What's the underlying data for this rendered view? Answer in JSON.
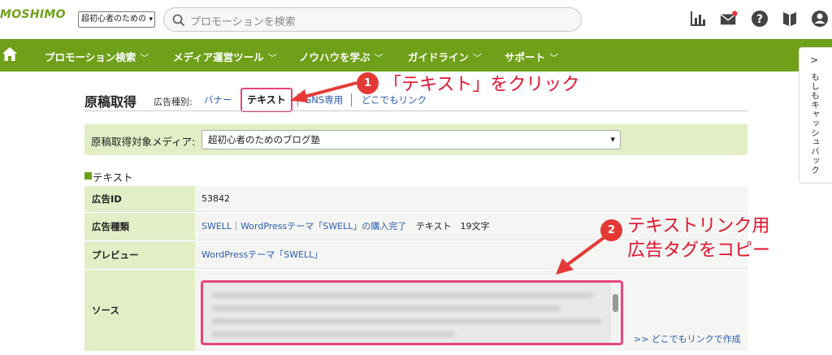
{
  "header": {
    "logo": "MOSHIMO",
    "media_select": "超初心者のための",
    "search_placeholder": "プロモーションを検索"
  },
  "nav": {
    "items": [
      {
        "label": "プロモーション検索"
      },
      {
        "label": "メディア運営ツール"
      },
      {
        "label": "ノウハウを学ぶ"
      },
      {
        "label": "ガイドライン"
      },
      {
        "label": "サポート"
      }
    ]
  },
  "side_tab": {
    "label": "もしもキャッシュバック"
  },
  "page": {
    "title": "原稿取得",
    "type_label": "広告種別:",
    "tabs": {
      "banner": "バナー",
      "text": "テキスト",
      "sns": "SNS専用",
      "anywhere": "どこでもリンク"
    },
    "media_label": "原稿取得対象メディア:",
    "media_value": "超初心者のためのブログ塾",
    "section_title": "テキスト"
  },
  "table": {
    "ad_id_label": "広告ID",
    "ad_id_value": "53842",
    "ad_type_label": "広告種類",
    "ad_type_link": "SWELL｜WordPressテーマ「SWELL」の購入完了",
    "ad_type_text": "テキスト　19文字",
    "preview_label": "プレビュー",
    "preview_link": "WordPressテーマ「SWELL」",
    "source_label": "ソース",
    "anywhere_link": ">> どこでもリンクで作成"
  },
  "annotations": {
    "badge1": "1",
    "note1": "「テキスト」をクリック",
    "badge2": "2",
    "note2_line1": "テキストリンク用",
    "note2_line2": "広告タグをコピー"
  },
  "colors": {
    "brand_green": "#6fa019",
    "highlight_pink": "#e8457a",
    "annotation_red": "#e0142e",
    "link_blue": "#2a5db0"
  }
}
